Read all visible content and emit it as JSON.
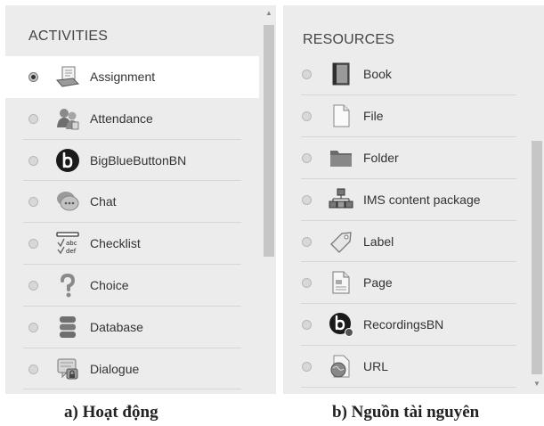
{
  "panel_a": {
    "title": "ACTIVITIES",
    "items": [
      {
        "label": "Assignment",
        "icon": "assignment-icon",
        "selected": true
      },
      {
        "label": "Attendance",
        "icon": "attendance-icon",
        "selected": false
      },
      {
        "label": "BigBlueButtonBN",
        "icon": "bigbluebutton-icon",
        "selected": false
      },
      {
        "label": "Chat",
        "icon": "chat-icon",
        "selected": false
      },
      {
        "label": "Checklist",
        "icon": "checklist-icon",
        "selected": false
      },
      {
        "label": "Choice",
        "icon": "choice-icon",
        "selected": false
      },
      {
        "label": "Database",
        "icon": "database-icon",
        "selected": false
      },
      {
        "label": "Dialogue",
        "icon": "dialogue-icon",
        "selected": false
      }
    ]
  },
  "panel_b": {
    "title": "RESOURCES",
    "items": [
      {
        "label": "Book",
        "icon": "book-icon",
        "selected": false
      },
      {
        "label": "File",
        "icon": "file-icon",
        "selected": false
      },
      {
        "label": "Folder",
        "icon": "folder-icon",
        "selected": false
      },
      {
        "label": "IMS content package",
        "icon": "ims-package-icon",
        "selected": false
      },
      {
        "label": "Label",
        "icon": "label-icon",
        "selected": false
      },
      {
        "label": "Page",
        "icon": "page-icon",
        "selected": false
      },
      {
        "label": "RecordingsBN",
        "icon": "recordings-icon",
        "selected": false
      },
      {
        "label": "URL",
        "icon": "url-icon",
        "selected": false
      }
    ]
  },
  "captions": {
    "a": "a) Hoạt động",
    "b": "b) Nguồn tài nguyên"
  }
}
